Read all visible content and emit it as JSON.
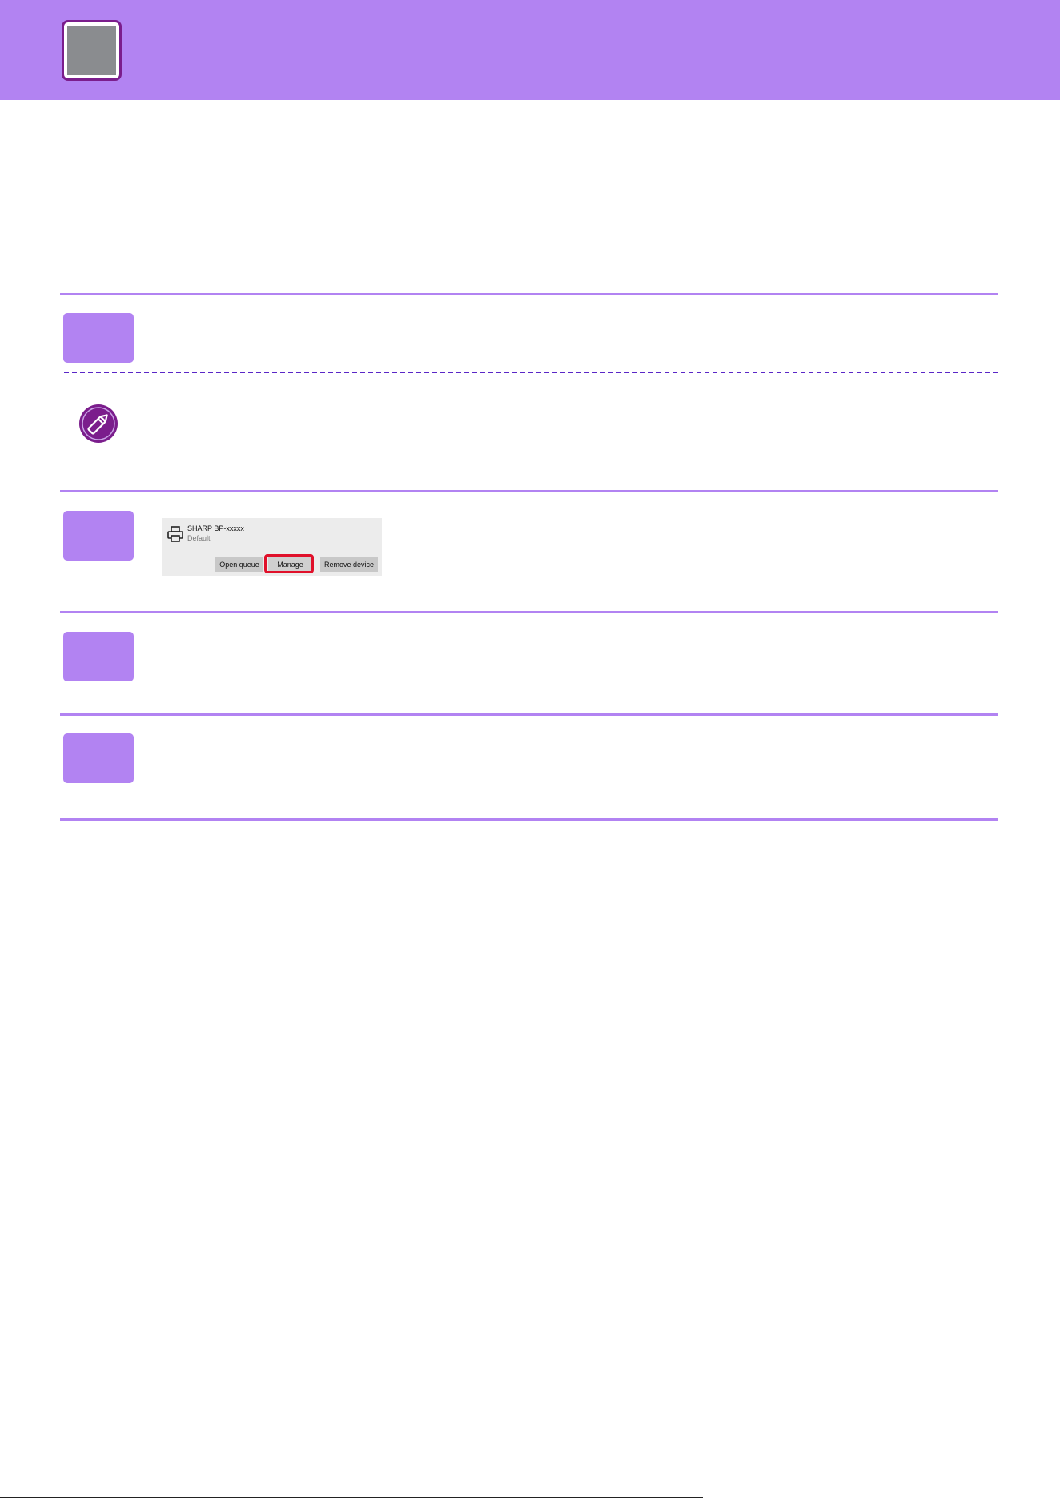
{
  "colors": {
    "accent": "#b283f2",
    "note_icon": "#7b1d8c",
    "highlight": "#e0102a",
    "dashed_rule": "#5a27c7"
  },
  "note": {
    "icon": "pencil-icon"
  },
  "printer_card": {
    "icon": "printer-icon",
    "name": "SHARP BP-xxxxx",
    "status": "Default",
    "buttons": {
      "open_queue": "Open queue",
      "manage": "Manage",
      "remove_device": "Remove device"
    },
    "highlighted_button": "Manage"
  }
}
